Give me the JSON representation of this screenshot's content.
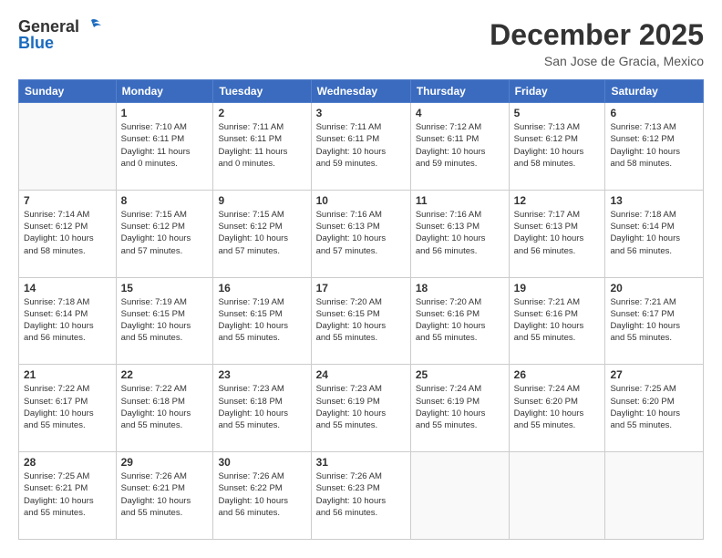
{
  "header": {
    "logo_general": "General",
    "logo_blue": "Blue",
    "month": "December 2025",
    "location": "San Jose de Gracia, Mexico"
  },
  "days_of_week": [
    "Sunday",
    "Monday",
    "Tuesday",
    "Wednesday",
    "Thursday",
    "Friday",
    "Saturday"
  ],
  "weeks": [
    [
      {
        "num": "",
        "info": ""
      },
      {
        "num": "1",
        "info": "Sunrise: 7:10 AM\nSunset: 6:11 PM\nDaylight: 11 hours\nand 0 minutes."
      },
      {
        "num": "2",
        "info": "Sunrise: 7:11 AM\nSunset: 6:11 PM\nDaylight: 11 hours\nand 0 minutes."
      },
      {
        "num": "3",
        "info": "Sunrise: 7:11 AM\nSunset: 6:11 PM\nDaylight: 10 hours\nand 59 minutes."
      },
      {
        "num": "4",
        "info": "Sunrise: 7:12 AM\nSunset: 6:11 PM\nDaylight: 10 hours\nand 59 minutes."
      },
      {
        "num": "5",
        "info": "Sunrise: 7:13 AM\nSunset: 6:12 PM\nDaylight: 10 hours\nand 58 minutes."
      },
      {
        "num": "6",
        "info": "Sunrise: 7:13 AM\nSunset: 6:12 PM\nDaylight: 10 hours\nand 58 minutes."
      }
    ],
    [
      {
        "num": "7",
        "info": "Sunrise: 7:14 AM\nSunset: 6:12 PM\nDaylight: 10 hours\nand 58 minutes."
      },
      {
        "num": "8",
        "info": "Sunrise: 7:15 AM\nSunset: 6:12 PM\nDaylight: 10 hours\nand 57 minutes."
      },
      {
        "num": "9",
        "info": "Sunrise: 7:15 AM\nSunset: 6:12 PM\nDaylight: 10 hours\nand 57 minutes."
      },
      {
        "num": "10",
        "info": "Sunrise: 7:16 AM\nSunset: 6:13 PM\nDaylight: 10 hours\nand 57 minutes."
      },
      {
        "num": "11",
        "info": "Sunrise: 7:16 AM\nSunset: 6:13 PM\nDaylight: 10 hours\nand 56 minutes."
      },
      {
        "num": "12",
        "info": "Sunrise: 7:17 AM\nSunset: 6:13 PM\nDaylight: 10 hours\nand 56 minutes."
      },
      {
        "num": "13",
        "info": "Sunrise: 7:18 AM\nSunset: 6:14 PM\nDaylight: 10 hours\nand 56 minutes."
      }
    ],
    [
      {
        "num": "14",
        "info": "Sunrise: 7:18 AM\nSunset: 6:14 PM\nDaylight: 10 hours\nand 56 minutes."
      },
      {
        "num": "15",
        "info": "Sunrise: 7:19 AM\nSunset: 6:15 PM\nDaylight: 10 hours\nand 55 minutes."
      },
      {
        "num": "16",
        "info": "Sunrise: 7:19 AM\nSunset: 6:15 PM\nDaylight: 10 hours\nand 55 minutes."
      },
      {
        "num": "17",
        "info": "Sunrise: 7:20 AM\nSunset: 6:15 PM\nDaylight: 10 hours\nand 55 minutes."
      },
      {
        "num": "18",
        "info": "Sunrise: 7:20 AM\nSunset: 6:16 PM\nDaylight: 10 hours\nand 55 minutes."
      },
      {
        "num": "19",
        "info": "Sunrise: 7:21 AM\nSunset: 6:16 PM\nDaylight: 10 hours\nand 55 minutes."
      },
      {
        "num": "20",
        "info": "Sunrise: 7:21 AM\nSunset: 6:17 PM\nDaylight: 10 hours\nand 55 minutes."
      }
    ],
    [
      {
        "num": "21",
        "info": "Sunrise: 7:22 AM\nSunset: 6:17 PM\nDaylight: 10 hours\nand 55 minutes."
      },
      {
        "num": "22",
        "info": "Sunrise: 7:22 AM\nSunset: 6:18 PM\nDaylight: 10 hours\nand 55 minutes."
      },
      {
        "num": "23",
        "info": "Sunrise: 7:23 AM\nSunset: 6:18 PM\nDaylight: 10 hours\nand 55 minutes."
      },
      {
        "num": "24",
        "info": "Sunrise: 7:23 AM\nSunset: 6:19 PM\nDaylight: 10 hours\nand 55 minutes."
      },
      {
        "num": "25",
        "info": "Sunrise: 7:24 AM\nSunset: 6:19 PM\nDaylight: 10 hours\nand 55 minutes."
      },
      {
        "num": "26",
        "info": "Sunrise: 7:24 AM\nSunset: 6:20 PM\nDaylight: 10 hours\nand 55 minutes."
      },
      {
        "num": "27",
        "info": "Sunrise: 7:25 AM\nSunset: 6:20 PM\nDaylight: 10 hours\nand 55 minutes."
      }
    ],
    [
      {
        "num": "28",
        "info": "Sunrise: 7:25 AM\nSunset: 6:21 PM\nDaylight: 10 hours\nand 55 minutes."
      },
      {
        "num": "29",
        "info": "Sunrise: 7:26 AM\nSunset: 6:21 PM\nDaylight: 10 hours\nand 55 minutes."
      },
      {
        "num": "30",
        "info": "Sunrise: 7:26 AM\nSunset: 6:22 PM\nDaylight: 10 hours\nand 56 minutes."
      },
      {
        "num": "31",
        "info": "Sunrise: 7:26 AM\nSunset: 6:23 PM\nDaylight: 10 hours\nand 56 minutes."
      },
      {
        "num": "",
        "info": ""
      },
      {
        "num": "",
        "info": ""
      },
      {
        "num": "",
        "info": ""
      }
    ]
  ]
}
